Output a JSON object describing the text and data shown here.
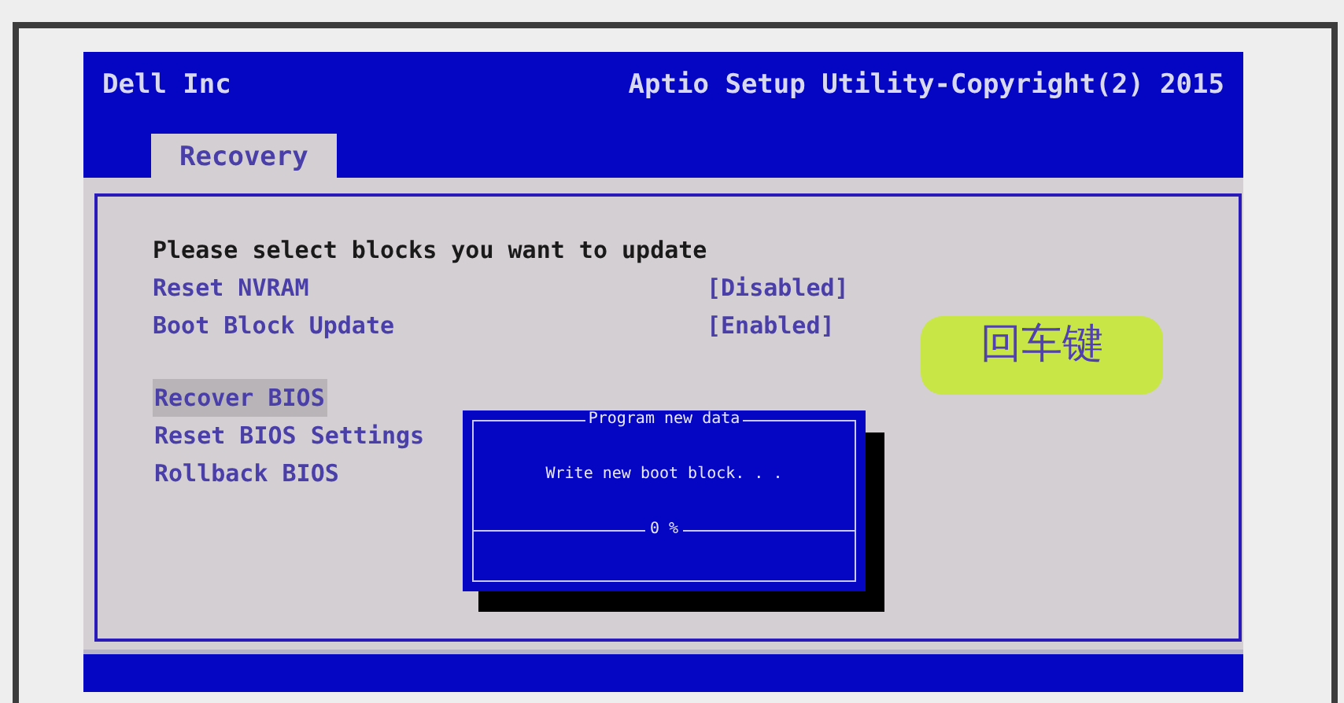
{
  "header": {
    "vendor": "Dell Inc",
    "title": "Aptio Setup Utility-Copyright(2) 2015"
  },
  "tabs": [
    {
      "label": "Recovery",
      "selected": true
    }
  ],
  "prompt": "Please select blocks you want to update",
  "options": [
    {
      "label": "Reset NVRAM",
      "value": "[Disabled]"
    },
    {
      "label": "Boot Block Update",
      "value": "[Enabled]"
    }
  ],
  "actions": [
    {
      "label": "Recover BIOS",
      "selected": true
    },
    {
      "label": "Reset BIOS Settings",
      "selected": false
    },
    {
      "label": "Rollback BIOS",
      "selected": false
    }
  ],
  "dialog": {
    "title": "Program new data",
    "message": "Write new boot block. . .",
    "progress_label": "0 %"
  },
  "annotation": {
    "text": "回车键"
  }
}
